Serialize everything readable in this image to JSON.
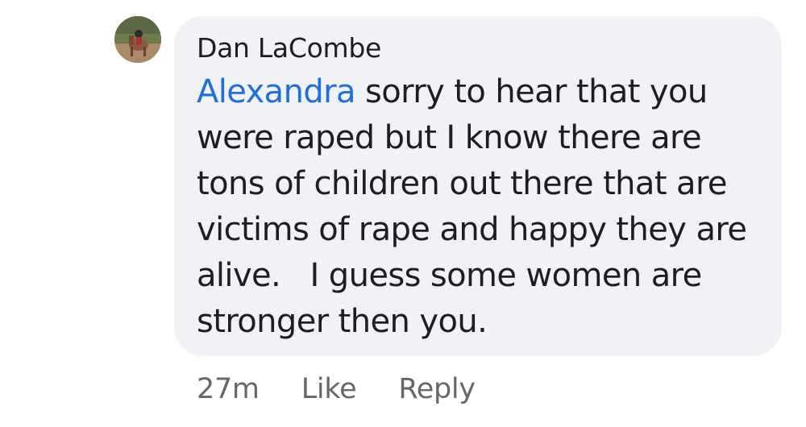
{
  "comment": {
    "author": "Dan LaCombe",
    "mention": "Alexandra",
    "text": " sorry to hear that you were raped but I know there are tons of children out there that are victims of rape and happy they are alive.   I guess some women are stronger then you.",
    "timestamp": "27m",
    "like_label": "Like",
    "reply_label": "Reply"
  },
  "colors": {
    "bubble": "#f0f2f5",
    "mention": "#216fdb",
    "meta": "#65676b"
  }
}
